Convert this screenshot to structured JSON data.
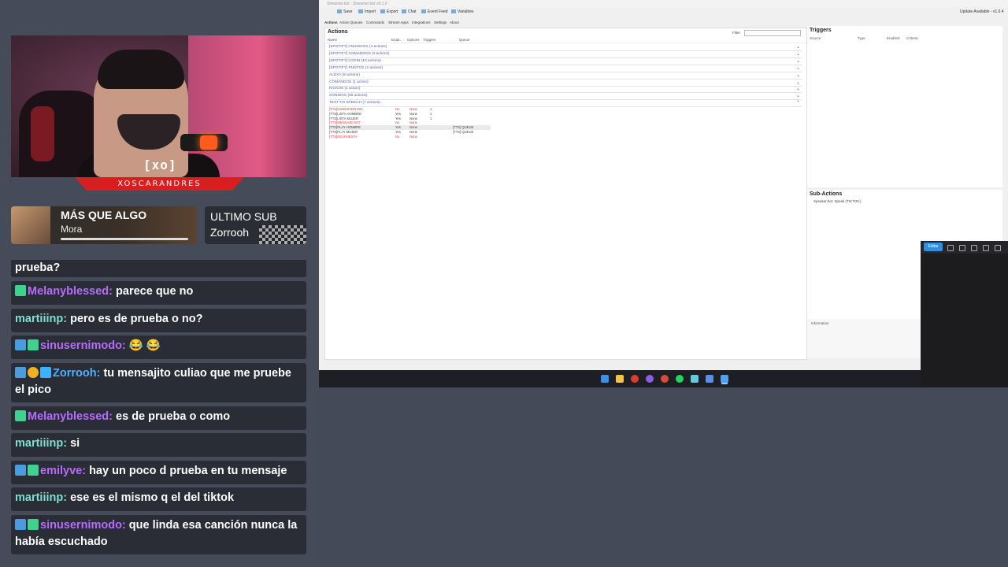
{
  "stream": {
    "streamer_logo": "[xo]",
    "streamer_name": "XOSCARANDRES",
    "now_playing": {
      "title": "MÁS QUE ALGO",
      "artist": "Mora"
    },
    "last_sub": {
      "label": "ULTIMO SUB",
      "name": "Zorrooh"
    }
  },
  "chat": [
    {
      "user": "",
      "text": "prueba?",
      "color": "#ffffff",
      "badges": []
    },
    {
      "user": "Melanyblessed:",
      "text": "parece que no",
      "color": "#b56cff",
      "badges": [
        "green"
      ]
    },
    {
      "user": "martiiinp:",
      "text": "pero es de prueba o no?",
      "color": "#7de0d2",
      "badges": []
    },
    {
      "user": "sinusernimodo:",
      "text": "😂 😂",
      "color": "#b56cff",
      "badges": [
        "sword",
        "green"
      ]
    },
    {
      "user": "Zorrooh:",
      "text": "tu mensajito culiao que me pruebe el pico",
      "color": "#4fb0ff",
      "badges": [
        "sword",
        "gold",
        "cube"
      ]
    },
    {
      "user": "Melanyblessed:",
      "text": "es de prueba o como",
      "color": "#b56cff",
      "badges": [
        "green"
      ]
    },
    {
      "user": "martiiinp:",
      "text": "si",
      "color": "#7de0d2",
      "badges": []
    },
    {
      "user": "emilyve:",
      "text": "hay un poco d prueba en tu mensaje",
      "color": "#b56cff",
      "badges": [
        "sword",
        "green"
      ]
    },
    {
      "user": "martiiinp:",
      "text": "ese es el mismo q el del tiktok",
      "color": "#7de0d2",
      "badges": []
    },
    {
      "user": "sinusernimodo:",
      "text": "que linda esa canción nunca la había escuchado",
      "color": "#b56cff",
      "badges": [
        "sword",
        "green"
      ]
    }
  ],
  "app": {
    "title": "Streamer.bot - Streamer.bot v0.1.0",
    "toolbar": {
      "save": "Save",
      "import": "Import",
      "export": "Export",
      "chat": "Chat",
      "event_feed": "Event Feed",
      "variables": "Variables",
      "update": "Update Available - v1.0.4"
    },
    "tabs": [
      "Actions",
      "Action Queues",
      "Commands",
      "Stream Apps",
      "Integrations",
      "Settings",
      "About"
    ],
    "actions_title": "Actions",
    "filter_label": "Filter",
    "columns": [
      "Name",
      "Enab..",
      "Options",
      "Triggers",
      "Queue"
    ],
    "groups": [
      "[SPOTIFY] ANUNCIOS (4 actions)",
      "[SPOTIFY] COMANDOS (3 actions)",
      "[SPOTIFY] LOGIN (10 actions)",
      "[SPOTIFY] PUNTOS (2 actions)",
      "ALEXA (8 actions)",
      "COMANDOS (1 action)",
      "KICKOS (1 action)",
      "SONIDOS (65 actions)",
      "TEXT TO SPEECH (7 actions)"
    ],
    "rows": [
      {
        "name": "[TTS]CONDICION DEL",
        "enabled": "No",
        "options": "None",
        "triggers": "1",
        "queue": "",
        "disabled": true
      },
      {
        "name": "[TTS]LISTA HOMBRE",
        "enabled": "Yes",
        "options": "None",
        "triggers": "1",
        "queue": "",
        "disabled": false
      },
      {
        "name": "[TTS]LISTA MUJER",
        "enabled": "Yes",
        "options": "None",
        "triggers": "1",
        "queue": "",
        "disabled": false
      },
      {
        "name": "[TTS]MENSAJE BOT",
        "enabled": "No",
        "options": "None",
        "triggers": "",
        "queue": "",
        "disabled": true
      },
      {
        "name": "[TTS]PLAY HOMBRE",
        "enabled": "Yes",
        "options": "None",
        "triggers": "",
        "queue": "[TTS] QUEUE",
        "disabled": false
      },
      {
        "name": "[TTS]PLAY MUJER",
        "enabled": "Yes",
        "options": "None",
        "triggers": "",
        "queue": "[TTS] QUEUE",
        "disabled": false
      },
      {
        "name": "[TTS]RESPUESTA",
        "enabled": "No",
        "options": "None",
        "triggers": "",
        "queue": "",
        "disabled": true
      }
    ],
    "triggers_title": "Triggers",
    "trigger_columns": [
      "Source",
      "Type",
      "Enabled",
      "Criteria"
    ],
    "subactions_title": "Sub-Actions",
    "subaction_item": "Speaker.bot: Speak (TIKTOK)",
    "info_label": "Information"
  },
  "editor": {
    "button": "Editar"
  }
}
